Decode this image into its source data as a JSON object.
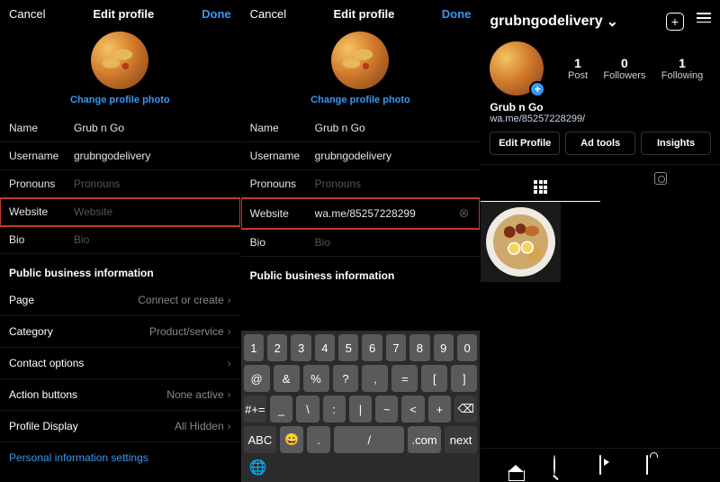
{
  "pane1": {
    "header": {
      "cancel": "Cancel",
      "title": "Edit profile",
      "done": "Done"
    },
    "change_photo": "Change profile photo",
    "fields": {
      "name": {
        "label": "Name",
        "value": "Grub n Go"
      },
      "username": {
        "label": "Username",
        "value": "grubngodelivery"
      },
      "pronouns": {
        "label": "Pronouns",
        "placeholder": "Pronouns"
      },
      "website": {
        "label": "Website",
        "placeholder": "Website"
      },
      "bio": {
        "label": "Bio",
        "placeholder": "Bio"
      }
    },
    "section": "Public business information",
    "options": {
      "page": {
        "label": "Page",
        "value": "Connect or create"
      },
      "category": {
        "label": "Category",
        "value": "Product/service"
      },
      "contact": {
        "label": "Contact options",
        "value": ""
      },
      "action": {
        "label": "Action buttons",
        "value": "None active"
      },
      "display": {
        "label": "Profile Display",
        "value": "All Hidden"
      }
    },
    "pis": "Personal information settings"
  },
  "pane2": {
    "header": {
      "cancel": "Cancel",
      "title": "Edit profile",
      "done": "Done"
    },
    "change_photo": "Change profile photo",
    "fields": {
      "name": {
        "label": "Name",
        "value": "Grub n Go"
      },
      "username": {
        "label": "Username",
        "value": "grubngodelivery"
      },
      "pronouns": {
        "label": "Pronouns",
        "placeholder": "Pronouns"
      },
      "website": {
        "label": "Website",
        "value": "wa.me/85257228299"
      },
      "bio": {
        "label": "Bio",
        "placeholder": "Bio"
      }
    },
    "section": "Public business information",
    "keyboard": {
      "r1": [
        "1",
        "2",
        "3",
        "4",
        "5",
        "6",
        "7",
        "8",
        "9",
        "0"
      ],
      "r2": [
        "@",
        "&",
        "%",
        "?",
        ",",
        "=",
        "[",
        "]"
      ],
      "r3": [
        "#+=",
        "_",
        "\\",
        ":",
        "|",
        "~",
        "<",
        "+",
        "⌫"
      ],
      "r4": [
        "ABC",
        "😀",
        ".",
        "/",
        ".com",
        "next"
      ]
    }
  },
  "pane3": {
    "username": "grubngodelivery",
    "stats": {
      "posts": {
        "n": "1",
        "l": "Post"
      },
      "followers": {
        "n": "0",
        "l": "Followers"
      },
      "following": {
        "n": "1",
        "l": "Following"
      }
    },
    "display_name": "Grub n Go",
    "link": "wa.me/85257228299/",
    "buttons": {
      "edit": "Edit Profile",
      "ads": "Ad tools",
      "insights": "Insights"
    }
  }
}
